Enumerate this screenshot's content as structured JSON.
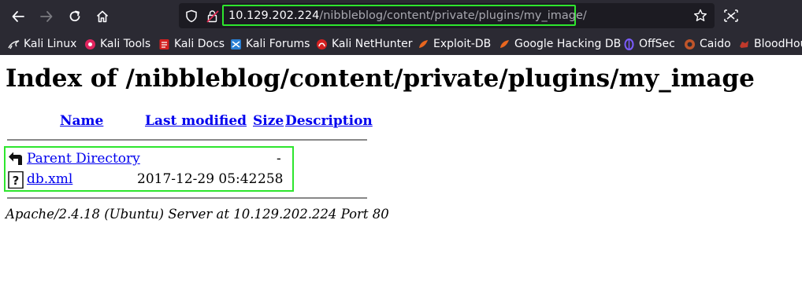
{
  "browser": {
    "url_host": "10.129.202.224",
    "url_path": "/nibbleblog/content/private/plugins/my_image/",
    "bookmarks": [
      {
        "label": "Kali Linux",
        "icon": "kali-dragon-icon",
        "color": "#e8e8e8"
      },
      {
        "label": "Kali Tools",
        "icon": "kali-tools-icon",
        "color": "#e0245e"
      },
      {
        "label": "Kali Docs",
        "icon": "kali-docs-icon",
        "color": "#d42020"
      },
      {
        "label": "Kali Forums",
        "icon": "kali-forums-icon",
        "color": "#2a7fd4"
      },
      {
        "label": "Kali NetHunter",
        "icon": "kali-nethunter-icon",
        "color": "#d42020"
      },
      {
        "label": "Exploit-DB",
        "icon": "exploit-db-icon",
        "color": "#e8661f"
      },
      {
        "label": "Google Hacking DB",
        "icon": "ghdb-icon",
        "color": "#e8661f"
      },
      {
        "label": "OffSec",
        "icon": "offsec-icon",
        "color": "#7b5cff"
      },
      {
        "label": "Caido",
        "icon": "caido-icon",
        "color": "#c0552a"
      },
      {
        "label": "BloodHou",
        "icon": "bloodhound-icon",
        "color": "#c0392b"
      }
    ]
  },
  "page": {
    "title": "Index of /nibbleblog/content/private/plugins/my_image",
    "headers": {
      "name": "Name",
      "last_modified": "Last modified",
      "size": "Size",
      "description": "Description"
    },
    "rows": [
      {
        "name": "Parent Directory",
        "modified": "",
        "size": "-",
        "icon": "back-arrow-icon"
      },
      {
        "name": "db.xml",
        "modified": "2017-12-29 05:42",
        "size": "258",
        "icon": "unknown-file-icon"
      }
    ],
    "footer": "Apache/2.4.18 (Ubuntu) Server at 10.129.202.224 Port 80"
  },
  "colors": {
    "highlight": "#2ee62e",
    "link": "#0000ee",
    "toolbar": "#2b2a33"
  }
}
